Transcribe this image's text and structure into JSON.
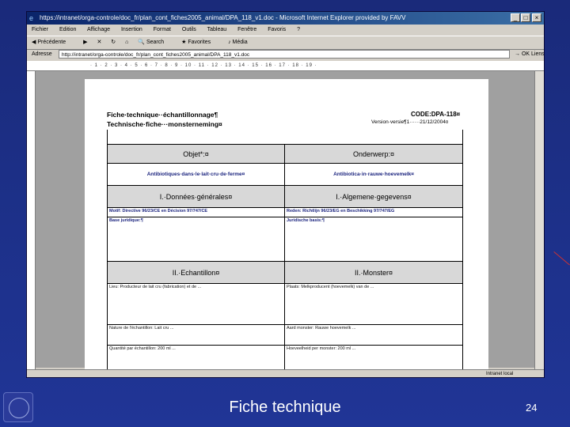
{
  "window": {
    "title": "https://intranet/orga-controle/doc_fr/plan_cont_fiches2005_animal/DPA_118_v1.doc - Microsoft Internet Explorer provided by FAVV"
  },
  "menu": [
    "Fichier",
    "Edition",
    "Affichage",
    "Insertion",
    "Format",
    "Outils",
    "Tableau",
    "Fenêtre",
    "Favoris",
    "?"
  ],
  "toolbar": {
    "back": "Précédente",
    "search": "Search",
    "favorites": "Favorites",
    "media": "Média"
  },
  "address": {
    "label": "Adresse",
    "url": "http://intranet/orga-controle/doc_fr/plan_cont_fiches2005_animal/DPA_118_v1.doc",
    "go": "OK",
    "links": "Liens"
  },
  "document": {
    "title_fr": "Fiche·technique··échantillonnage¶",
    "title_nl": "Technische·fiche···monsterneming¤",
    "code": "CODE:DPA-118¤",
    "version": "Version·versie¶1······21/12/2004¤",
    "row_objet": "Objet*:¤",
    "row_onderwerp": "Onderwerp:¤",
    "row_antibio_fr": "Antibiotiques·dans·le·lait·cru·de·ferme¤",
    "row_antibio_nl": "Antibiotica·in·rauwe·hoevemelk¤",
    "sec1_fr": "I.·Données·générales¤",
    "sec1_nl": "I.·Algemene·gegevens¤",
    "motif": "Motif: Directive 96/23/CE en Décision 97/747/CE",
    "reden": "Reden: Richtlijn 96/23/EG en Beschikking 97/747/EG",
    "base_juridique": "Base juridique:¶",
    "juridische": "Juridische basis:¶",
    "sec2_fr": "II.·Echantillon¤",
    "sec2_nl": "II.·Monster¤",
    "lieu": "Lieu: Producteur de lait cru (fabrication) et de ...",
    "plaats": "Plaats: Melkproducent (hoevemelk) van de ...",
    "nature": "Nature de l'échantillon: Lait cru ...",
    "aard": "Aard monster: Rauwe hoevemelk ...",
    "quantite": "Quantité par échantillon: 200 ml ...",
    "hoeveelheid": "Hoeveelheid per monster: 200 ml ..."
  },
  "statusbar": {
    "zone": "Intranet local"
  },
  "slide": {
    "title": "Fiche technique",
    "number": "24"
  }
}
